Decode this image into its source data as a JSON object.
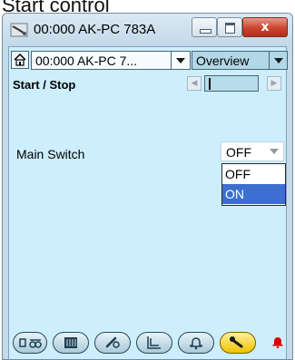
{
  "caption": "Start control",
  "window": {
    "title": "00:000 AK-PC 783A",
    "close_label": "x"
  },
  "toolbar": {
    "device_select": "00:000 AK-PC 7...",
    "view_select": "Overview"
  },
  "page": {
    "title": "Start / Stop"
  },
  "parameter": {
    "label": "Main Switch",
    "value": "OFF",
    "options": [
      "OFF",
      "ON"
    ],
    "highlighted_option": "ON"
  },
  "bottom_bar": {
    "icons": [
      "status-icon",
      "io-icon",
      "parameters-icon",
      "graph-icon",
      "alarms-icon",
      "service-icon"
    ],
    "active_icon": "service-icon"
  },
  "colors": {
    "client_bg": "#cdeefc",
    "selection": "#3d6fd0",
    "active_tab": "#f0c200",
    "alarm": "#e00000"
  }
}
